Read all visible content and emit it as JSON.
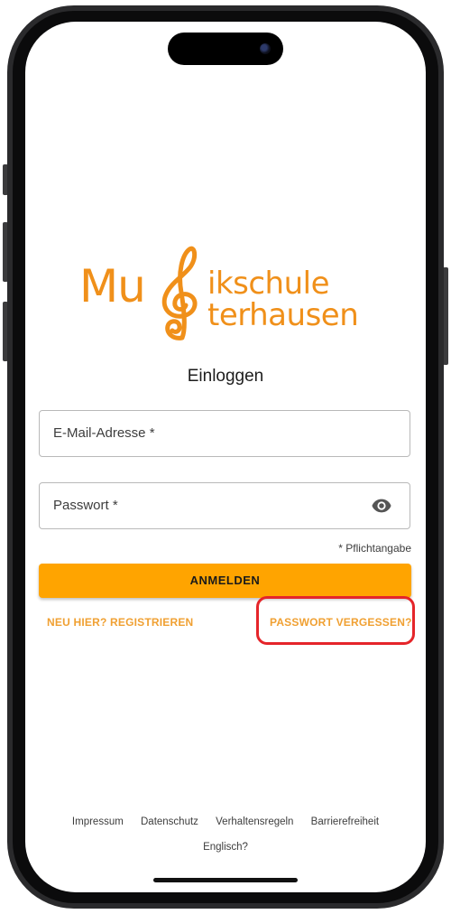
{
  "brand": {
    "line1": "Mu",
    "line2": "ikschule",
    "line3": "terhausen",
    "color": "#f0901a"
  },
  "login": {
    "title": "Einloggen",
    "email_label": "E-Mail-Adresse *",
    "password_label": "Passwort *",
    "required_note": "* Pflichtangabe",
    "submit_label": "ANMELDEN",
    "register_link": "NEU HIER? REGISTRIEREN",
    "forgot_link": "PASSWORT VERGESSEN?",
    "accent": "#ffa400"
  },
  "footer": {
    "links": [
      "Impressum",
      "Datenschutz",
      "Verhaltensregeln",
      "Barrierefreiheit"
    ],
    "language": "Englisch?"
  },
  "icons": {
    "password_visibility": "eye-icon"
  }
}
